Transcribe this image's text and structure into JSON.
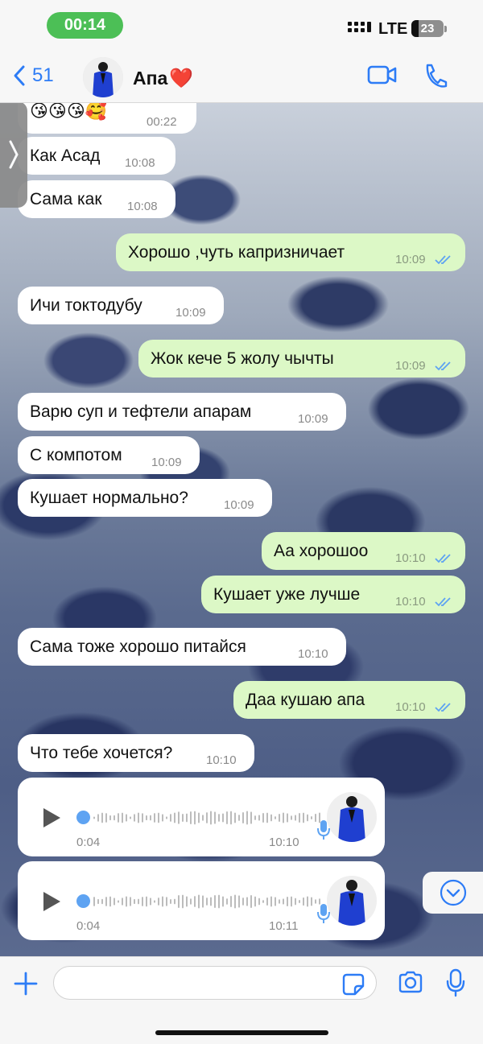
{
  "status_bar": {
    "time": "00:14",
    "network": "LTE",
    "battery": "23"
  },
  "header": {
    "back_count": "51",
    "contact_name": "Апа",
    "contact_emoji": "❤️",
    "icons": [
      "chevron-left-icon",
      "video-call-icon",
      "phone-icon"
    ]
  },
  "messages": [
    {
      "dir": "in",
      "text": "😘😘😘🥰",
      "time": "00:22"
    },
    {
      "dir": "in",
      "text": "Как Асад",
      "time": "10:08"
    },
    {
      "dir": "in",
      "text": "Сама как",
      "time": "10:08"
    },
    {
      "dir": "out",
      "text": "Хорошо ,чуть капризничает",
      "time": "10:09",
      "read": true
    },
    {
      "dir": "in",
      "text": "Ичи токтодубу",
      "time": "10:09"
    },
    {
      "dir": "out",
      "text": "Жок кече 5 жолу чычты",
      "time": "10:09",
      "read": true
    },
    {
      "dir": "in",
      "text": "Варю суп и тефтели апарам",
      "time": "10:09"
    },
    {
      "dir": "in",
      "text": "С компотом",
      "time": "10:09"
    },
    {
      "dir": "in",
      "text": "Кушает нормально?",
      "time": "10:09"
    },
    {
      "dir": "out",
      "text": "Аа хорошоо",
      "time": "10:10",
      "read": true
    },
    {
      "dir": "out",
      "text": "Кушает уже лучше",
      "time": "10:10",
      "read": true
    },
    {
      "dir": "in",
      "text": "Сама тоже хорошо питайся",
      "time": "10:10"
    },
    {
      "dir": "out",
      "text": "Даа кушаю апа",
      "time": "10:10",
      "read": true
    },
    {
      "dir": "in",
      "text": "Что тебе хочется?",
      "time": "10:10"
    }
  ],
  "voice_messages": [
    {
      "duration": "0:04",
      "time": "10:10"
    },
    {
      "duration": "0:04",
      "time": "10:11"
    }
  ],
  "composer": {
    "value": "",
    "placeholder": "",
    "icons": [
      "plus-icon",
      "sticker-icon",
      "camera-icon",
      "microphone-icon"
    ]
  },
  "colors": {
    "accent": "#2d7cf6",
    "outgoing_bubble": "#dcf8c6",
    "incoming_bubble": "#ffffff",
    "time_pill": "#4cbf56"
  }
}
